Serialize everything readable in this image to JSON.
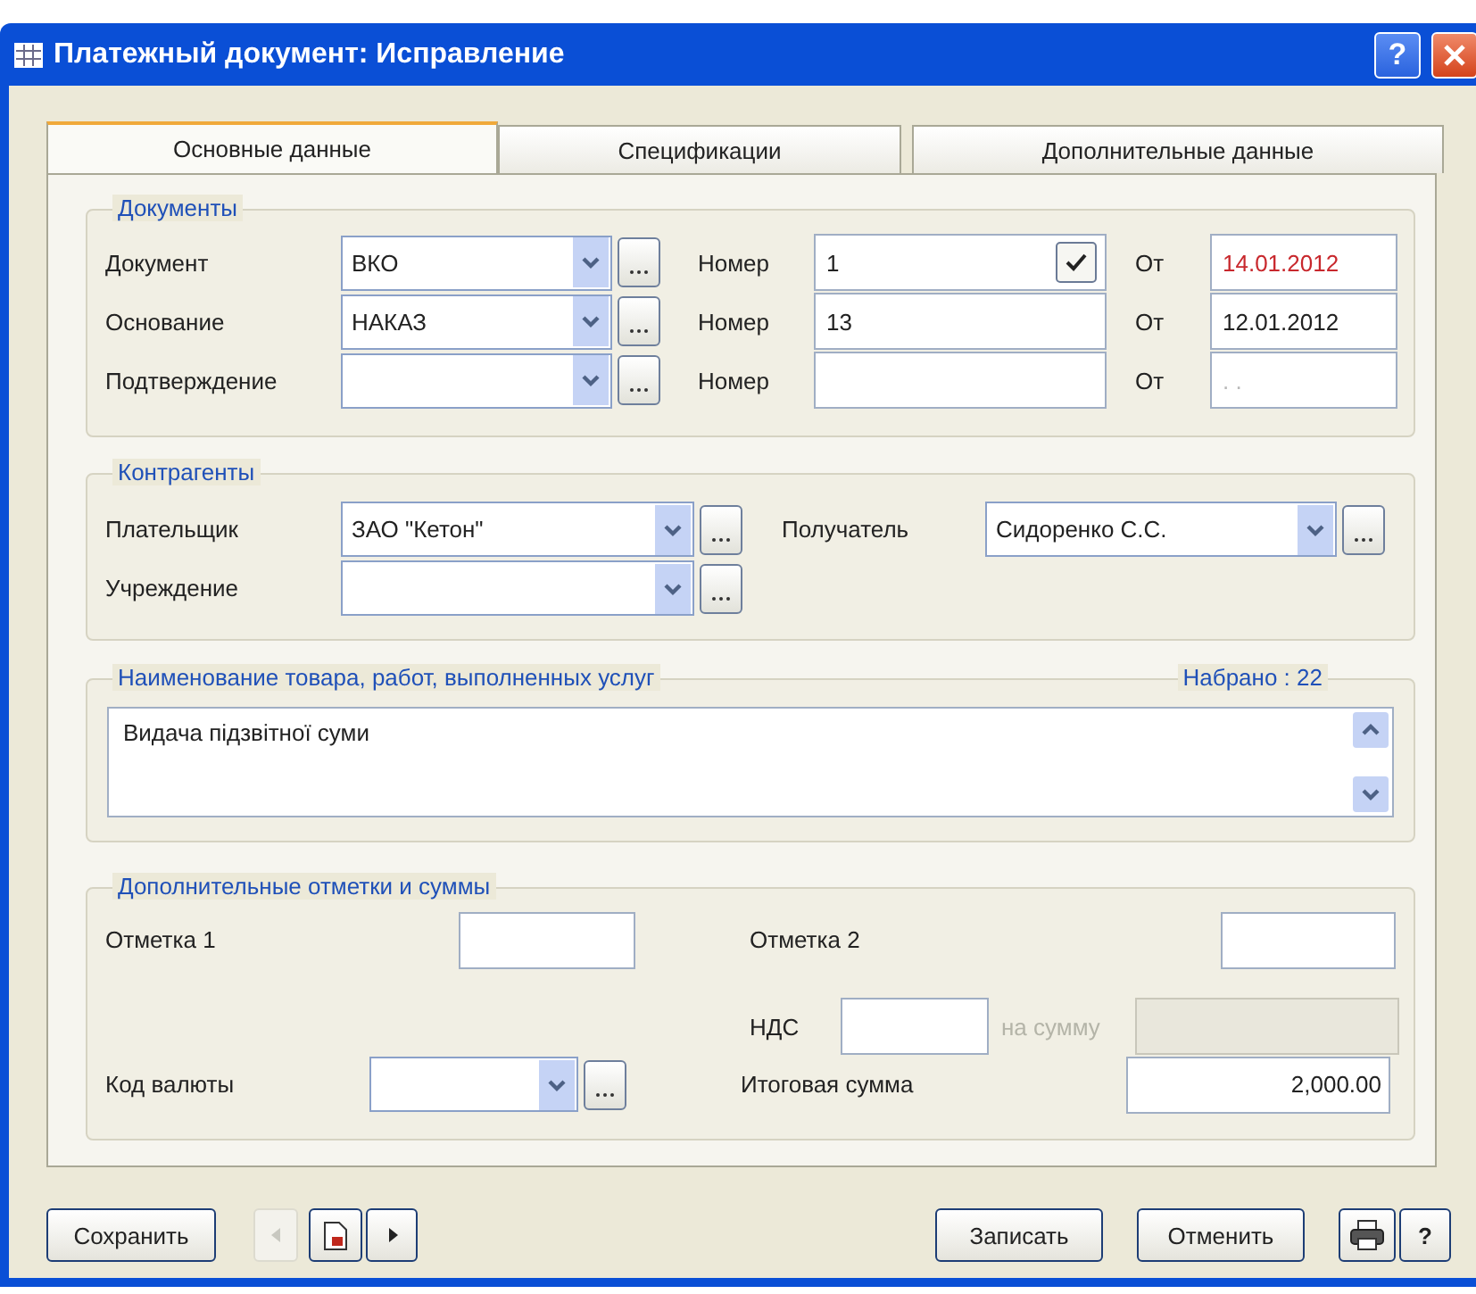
{
  "window": {
    "title": "Платежный документ: Исправление",
    "help": "?"
  },
  "tabs": [
    {
      "label": "Основные данные",
      "selected": true
    },
    {
      "label": "Спецификации",
      "selected": false
    },
    {
      "label": "Дополнительные данные",
      "selected": false
    }
  ],
  "documents": {
    "title": "Документы",
    "rows": [
      {
        "label": "Документ",
        "value": "ВКО",
        "number_label": "Номер",
        "number": {
          "value": "1",
          "kind": "check",
          "checked": true
        },
        "date_label": "От",
        "date": {
          "value": "14.01.2012",
          "error": true
        }
      },
      {
        "label": "Основание",
        "value": "НАКАЗ",
        "number_label": "Номер",
        "number": {
          "value": "13",
          "kind": "plain"
        },
        "date_label": "От",
        "date": {
          "value": "12.01.2012",
          "error": false
        }
      },
      {
        "label": "Подтверждение",
        "number_label": "Номер",
        "number": {
          "kind": "plain"
        },
        "date_label": "От",
        "date": {
          "placeholder": ". .",
          "error": false
        }
      }
    ]
  },
  "counterparties": {
    "title": "Контрагенты",
    "payer_label": "Плательщик",
    "payer": "ЗАО \"Кетон\"",
    "recipient_label": "Получатель",
    "recipient": "Сидоренко С.С.",
    "institution_label": "Учреждение"
  },
  "goods": {
    "title": "Наименование товара, работ, выполненных услуг",
    "counter": "Набрано : 22",
    "text": "Видача підзвітної суми"
  },
  "extra": {
    "title": "Дополнительные отметки и суммы",
    "mark1_label": "Отметка 1",
    "mark2_label": "Отметка 2",
    "vat_label": "НДС",
    "on_sum": {
      "label": "на сумму",
      "disabled": true
    },
    "currency_label": "Код валюты",
    "total_label": "Итоговая сумма",
    "total": "2,000.00"
  },
  "buttons": {
    "save": "Сохранить",
    "prev": {
      "disabled": true
    },
    "next": {
      "disabled": false
    },
    "write": "Записать",
    "cancel": "Отменить",
    "help": "?"
  }
}
